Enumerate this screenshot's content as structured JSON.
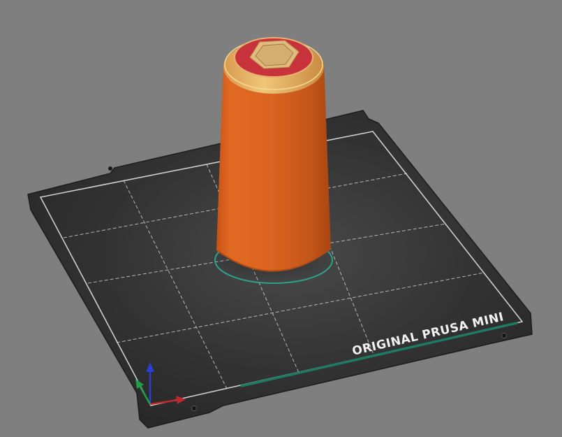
{
  "viewport": {
    "background_color": "#7f7f7f"
  },
  "bed": {
    "label": "ORIGINAL PRUSA MINI",
    "sheet_color": "#2b2b2b",
    "grid_color": "#e6e6e6",
    "accent_stripe_color": "#1f7a62"
  },
  "object": {
    "body_color": "#d9621e",
    "top_band_color": "#e8b86a",
    "top_face_color": "#c8323a",
    "hole_color": "#d7b27a",
    "selection_outline_color": "#2aa38a"
  },
  "axes_gizmo": {
    "x_color": "#c0282e",
    "y_color": "#1f9d4a",
    "z_color": "#2a3fcf"
  }
}
